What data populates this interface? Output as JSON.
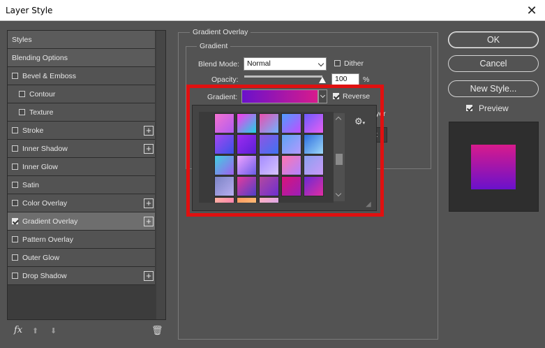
{
  "window": {
    "title": "Layer Style",
    "close_glyph": "✕"
  },
  "styles_list": {
    "items": [
      {
        "label": "Styles",
        "checkbox": false,
        "checked": false,
        "plus": false,
        "header": true,
        "indent": false
      },
      {
        "label": "Blending Options",
        "checkbox": false,
        "checked": false,
        "plus": false,
        "header": true,
        "indent": false
      },
      {
        "label": "Bevel & Emboss",
        "checkbox": true,
        "checked": false,
        "plus": false,
        "header": false,
        "indent": false
      },
      {
        "label": "Contour",
        "checkbox": true,
        "checked": false,
        "plus": false,
        "header": false,
        "indent": true
      },
      {
        "label": "Texture",
        "checkbox": true,
        "checked": false,
        "plus": false,
        "header": false,
        "indent": true
      },
      {
        "label": "Stroke",
        "checkbox": true,
        "checked": false,
        "plus": true,
        "header": false,
        "indent": false
      },
      {
        "label": "Inner Shadow",
        "checkbox": true,
        "checked": false,
        "plus": true,
        "header": false,
        "indent": false
      },
      {
        "label": "Inner Glow",
        "checkbox": true,
        "checked": false,
        "plus": false,
        "header": false,
        "indent": false
      },
      {
        "label": "Satin",
        "checkbox": true,
        "checked": false,
        "plus": false,
        "header": false,
        "indent": false
      },
      {
        "label": "Color Overlay",
        "checkbox": true,
        "checked": false,
        "plus": true,
        "header": false,
        "indent": false
      },
      {
        "label": "Gradient Overlay",
        "checkbox": true,
        "checked": true,
        "plus": true,
        "header": false,
        "indent": false,
        "active": true
      },
      {
        "label": "Pattern Overlay",
        "checkbox": true,
        "checked": false,
        "plus": false,
        "header": false,
        "indent": false
      },
      {
        "label": "Outer Glow",
        "checkbox": true,
        "checked": false,
        "plus": false,
        "header": false,
        "indent": false
      },
      {
        "label": "Drop Shadow",
        "checkbox": true,
        "checked": false,
        "plus": true,
        "header": false,
        "indent": false
      }
    ],
    "plus_glyph": "+",
    "footer": {
      "fx_label": "fx",
      "move_up_glyph": "⬆",
      "move_down_glyph": "⬇",
      "trash_glyph": "🗑"
    }
  },
  "gradient_overlay": {
    "section_title": "Gradient Overlay",
    "group_title": "Gradient",
    "blend_mode_label": "Blend Mode:",
    "blend_mode_value": "Normal",
    "dither_label": "Dither",
    "dither_checked": false,
    "opacity_label": "Opacity:",
    "opacity_value": "100",
    "opacity_unit": "%",
    "opacity_fraction": 1.0,
    "gradient_label": "Gradient:",
    "reverse_label": "Reverse",
    "reverse_checked": true,
    "obscured_text": "yer",
    "obscured_text_2": "t",
    "gradient_colors": [
      "#6a11cb",
      "#d81b8c"
    ]
  },
  "gradient_picker": {
    "gear_glyph": "⚙",
    "gear_caret": "▾",
    "grip_glyph": "◢",
    "swatches": [
      [
        "#f472d0",
        "#b05cf0"
      ],
      [
        "#fe38ee",
        "#1fd3e6"
      ],
      [
        "#ea4fae",
        "#6fb3ff"
      ],
      [
        "#4f9dfd",
        "#c24dff"
      ],
      [
        "#6b5bfd",
        "#e85ff2"
      ],
      [
        "#a347f2",
        "#3b52e8"
      ],
      [
        "#9d2cf0",
        "#5a1fd8"
      ],
      [
        "#8e55e3",
        "#3f73f2"
      ],
      [
        "#5da3f4",
        "#b49aff"
      ],
      [
        "#2e6fe0",
        "#9cd7f7"
      ],
      [
        "#3fd0e0",
        "#a060f0"
      ],
      [
        "#f0a2ff",
        "#6c5de8"
      ],
      [
        "#a48cff",
        "#d7c3ff"
      ],
      [
        "#ff74b0",
        "#b084ff"
      ],
      [
        "#8aa0f0",
        "#ca9af7"
      ],
      [
        "#7c84c6",
        "#b8aef0"
      ],
      [
        "#e43b9c",
        "#4f3fc9"
      ],
      [
        "#b3489f",
        "#6c2fd0"
      ],
      [
        "#d9137a",
        "#9a1fb8"
      ],
      [
        "#6a2bd3",
        "#e12ca2"
      ],
      [
        "#ffb3a0",
        "#ff66b8"
      ],
      [
        "#ff9960",
        "#ffcc80"
      ],
      [
        "#ffb0c0",
        "#c8a0ff"
      ]
    ]
  },
  "buttons": {
    "ok": "OK",
    "cancel": "Cancel",
    "new_style": "New Style..."
  },
  "preview": {
    "label": "Preview",
    "checked": true
  }
}
